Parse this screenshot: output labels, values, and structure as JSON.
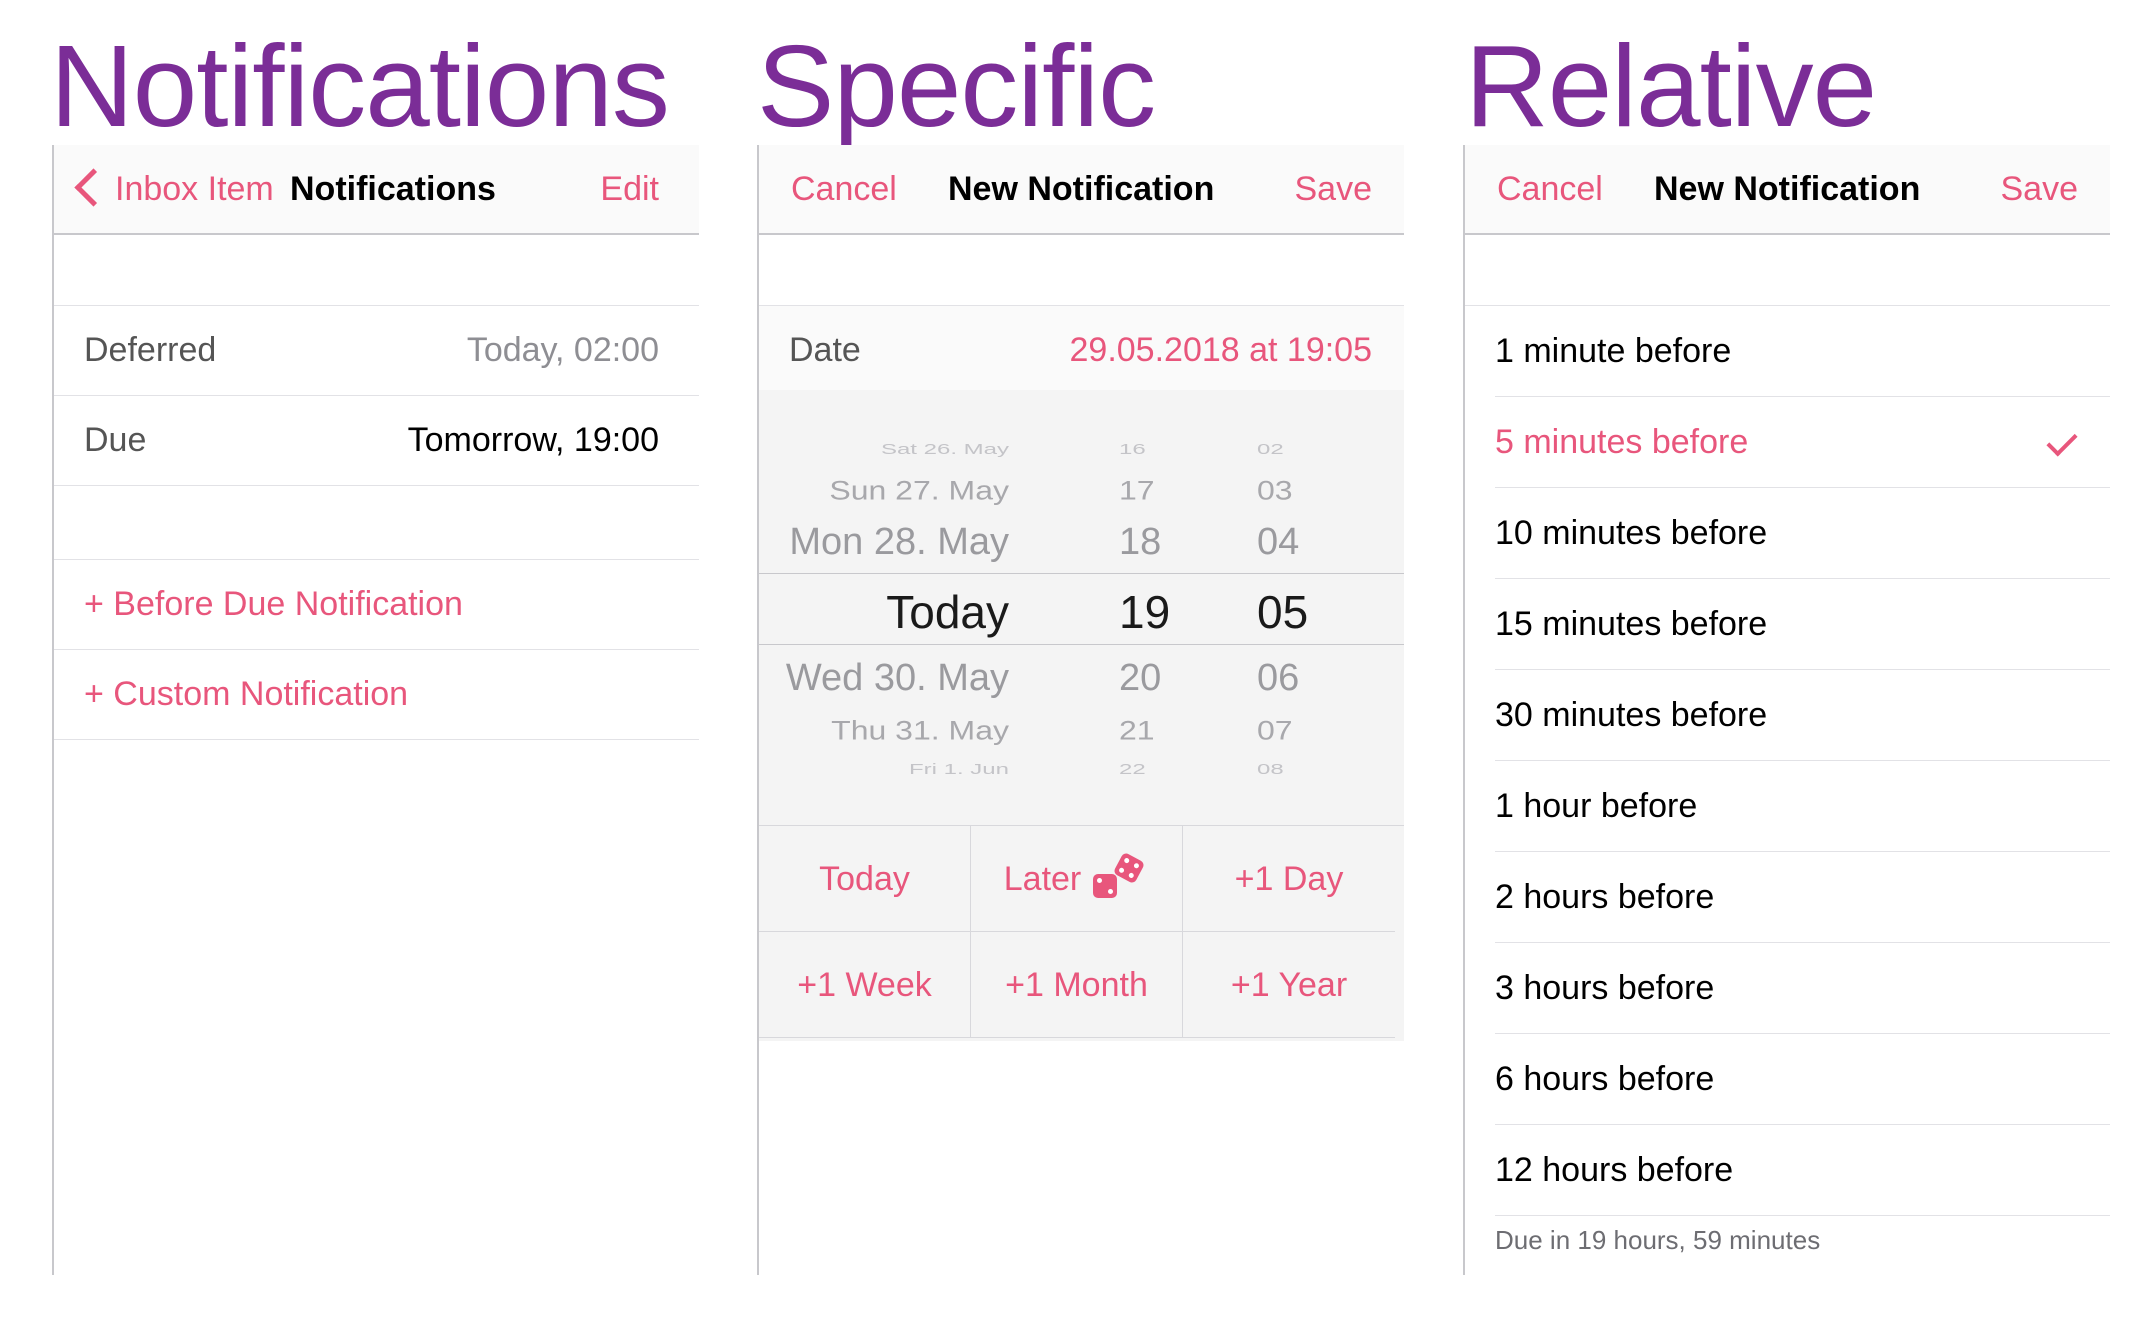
{
  "titles": {
    "notifications": "Notifications",
    "specific": "Specific",
    "relative": "Relative"
  },
  "panel1": {
    "nav": {
      "back_label": "Inbox Item",
      "title": "Notifications",
      "edit_label": "Edit"
    },
    "rows": [
      {
        "label": "Deferred",
        "value": "Today, 02:00"
      },
      {
        "label": "Due",
        "value": "Tomorrow, 19:00"
      }
    ],
    "actions": [
      {
        "label": "+ Before Due Notification"
      },
      {
        "label": "+ Custom Notification"
      }
    ]
  },
  "panel2": {
    "nav": {
      "cancel_label": "Cancel",
      "title": "New Notification",
      "save_label": "Save"
    },
    "date_row": {
      "label": "Date",
      "value": "29.05.2018 at 19:05"
    },
    "picker": {
      "days": [
        "Sat 26. May",
        "Sun 27. May",
        "Mon 28. May",
        "Today",
        "Wed 30. May",
        "Thu 31. May",
        "Fri 1. Jun"
      ],
      "hours": [
        "16",
        "17",
        "18",
        "19",
        "20",
        "21",
        "22"
      ],
      "minutes": [
        "02",
        "03",
        "04",
        "05",
        "06",
        "07",
        "08"
      ],
      "selected_index": 3
    },
    "buttons": [
      {
        "label": "Today"
      },
      {
        "label": "Later"
      },
      {
        "label": "+1 Day"
      },
      {
        "label": "+1 Week"
      },
      {
        "label": "+1 Month"
      },
      {
        "label": "+1 Year"
      }
    ],
    "dice_icon": "dice-icon"
  },
  "panel3": {
    "nav": {
      "cancel_label": "Cancel",
      "title": "New Notification",
      "save_label": "Save"
    },
    "options": [
      {
        "label": "1 minute before",
        "selected": false
      },
      {
        "label": "5 minutes before",
        "selected": true
      },
      {
        "label": "10 minutes before",
        "selected": false
      },
      {
        "label": "15 minutes before",
        "selected": false
      },
      {
        "label": "30 minutes before",
        "selected": false
      },
      {
        "label": "1 hour before",
        "selected": false
      },
      {
        "label": "2 hours before",
        "selected": false
      },
      {
        "label": "3 hours before",
        "selected": false
      },
      {
        "label": "6 hours before",
        "selected": false
      },
      {
        "label": "12 hours before",
        "selected": false
      }
    ],
    "footer": "Due in 19 hours, 59 minutes"
  },
  "colors": {
    "title_purple": "#7b2d97",
    "accent_pink": "#e8567c",
    "separator": "#c8c8cc"
  }
}
